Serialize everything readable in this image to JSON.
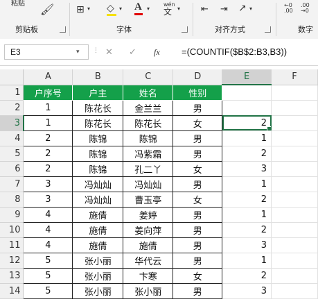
{
  "ribbon": {
    "group_clipboard": "剪贴板",
    "group_font": "字体",
    "group_alignment": "对齐方式",
    "group_number": "数字",
    "paste_label": "粘贴",
    "wen_label": "wén"
  },
  "formula_bar": {
    "name_box": "E3",
    "cancel_symbol": "✕",
    "enter_symbol": "✓",
    "fx_symbol": "fx",
    "formula": "=(COUNTIF($B$2:B3,B3))"
  },
  "grid": {
    "columns": [
      "A",
      "B",
      "C",
      "D",
      "E",
      "F"
    ],
    "rows": [
      {
        "num": "1",
        "cells": [
          "户序号",
          "户主",
          "姓名",
          "性别",
          "",
          ""
        ]
      },
      {
        "num": "2",
        "cells": [
          "1",
          "陈花长",
          "金兰兰",
          "男",
          "",
          ""
        ]
      },
      {
        "num": "3",
        "cells": [
          "1",
          "陈花长",
          "陈花长",
          "女",
          "2",
          ""
        ]
      },
      {
        "num": "4",
        "cells": [
          "2",
          "陈锦",
          "陈锦",
          "男",
          "1",
          ""
        ]
      },
      {
        "num": "5",
        "cells": [
          "2",
          "陈锦",
          "冯紫霜",
          "男",
          "2",
          ""
        ]
      },
      {
        "num": "6",
        "cells": [
          "2",
          "陈锦",
          "孔二丫",
          "女",
          "3",
          ""
        ]
      },
      {
        "num": "7",
        "cells": [
          "3",
          "冯灿灿",
          "冯灿灿",
          "男",
          "1",
          ""
        ]
      },
      {
        "num": "8",
        "cells": [
          "3",
          "冯灿灿",
          "曹玉亭",
          "女",
          "2",
          ""
        ]
      },
      {
        "num": "9",
        "cells": [
          "4",
          "施倩",
          "姜婷",
          "男",
          "1",
          ""
        ]
      },
      {
        "num": "10",
        "cells": [
          "4",
          "施倩",
          "姜向萍",
          "男",
          "2",
          ""
        ]
      },
      {
        "num": "11",
        "cells": [
          "4",
          "施倩",
          "施倩",
          "男",
          "3",
          ""
        ]
      },
      {
        "num": "12",
        "cells": [
          "5",
          "张小丽",
          "华代云",
          "男",
          "1",
          ""
        ]
      },
      {
        "num": "13",
        "cells": [
          "5",
          "张小丽",
          "卞寒",
          "女",
          "2",
          ""
        ]
      },
      {
        "num": "14",
        "cells": [
          "5",
          "张小丽",
          "张小丽",
          "男",
          "3",
          ""
        ]
      }
    ],
    "active_cell": "E3",
    "header_fill": "#14a04a",
    "accent": "#217346"
  }
}
